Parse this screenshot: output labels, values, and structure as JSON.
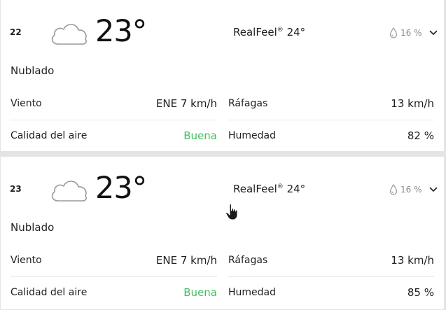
{
  "hours": [
    {
      "hour": "22",
      "temp": "23°",
      "icon": "cloud-icon",
      "realfeel_label": "RealFeel",
      "realfeel_mark": "®",
      "realfeel_value": "24°",
      "precip": "16 %",
      "phrase": "Nublado",
      "wind_label": "Viento",
      "wind_value": "ENE 7 km/h",
      "gusts_label": "Ráfagas",
      "gusts_value": "13 km/h",
      "air_label": "Calidad del aire",
      "air_value": "Buena",
      "humidity_label": "Humedad",
      "humidity_value": "82 %"
    },
    {
      "hour": "23",
      "temp": "23°",
      "icon": "cloud-icon",
      "realfeel_label": "RealFeel",
      "realfeel_mark": "®",
      "realfeel_value": "24°",
      "precip": "16 %",
      "phrase": "Nublado",
      "wind_label": "Viento",
      "wind_value": "ENE 7 km/h",
      "gusts_label": "Ráfagas",
      "gusts_value": "13 km/h",
      "air_label": "Calidad del aire",
      "air_value": "Buena",
      "humidity_label": "Humedad",
      "humidity_value": "85 %"
    }
  ],
  "colors": {
    "air_quality_good": "#3fbf5f",
    "muted_text": "#8a8a8a",
    "page_background": "#e4e4e4"
  }
}
